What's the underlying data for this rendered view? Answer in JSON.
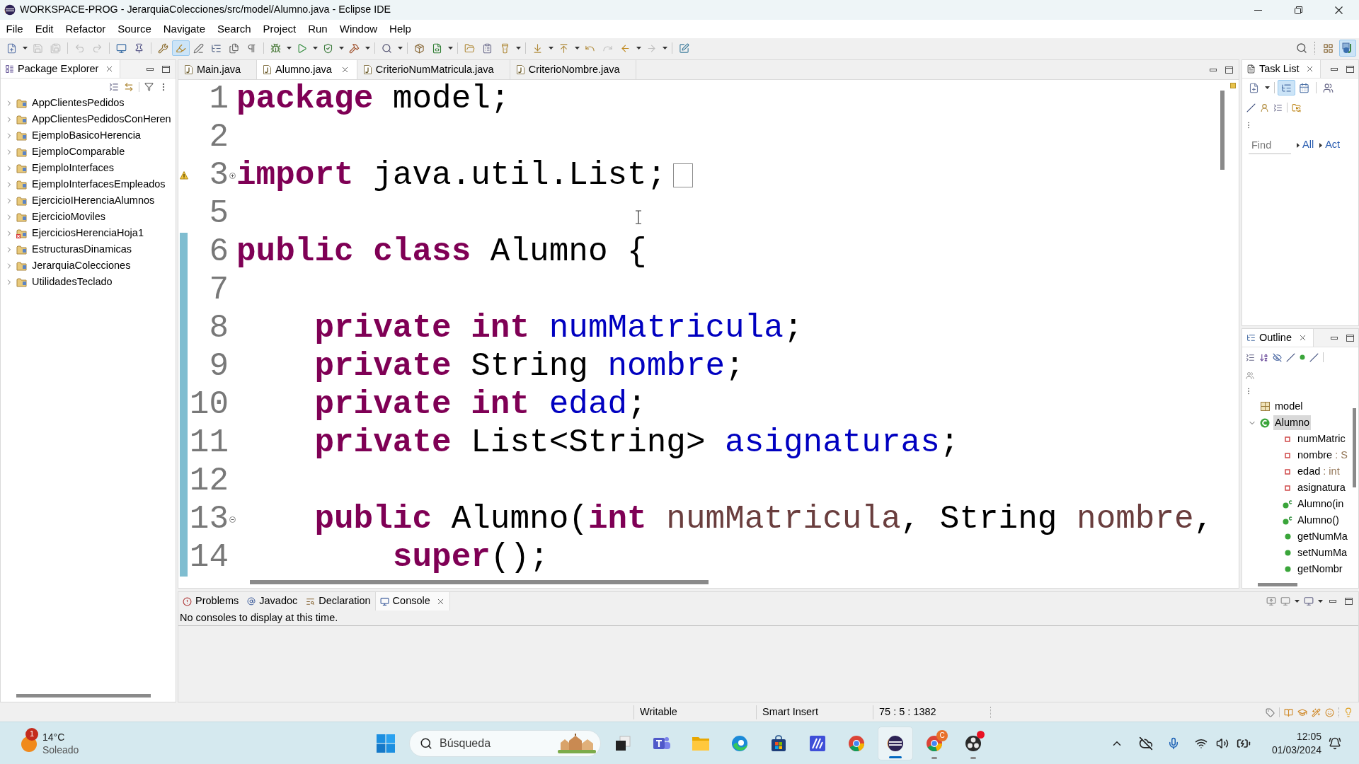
{
  "window": {
    "title": "WORKSPACE-PROG - JerarquiaColecciones/src/model/Alumno.java - Eclipse IDE"
  },
  "menu": [
    "File",
    "Edit",
    "Refactor",
    "Source",
    "Navigate",
    "Search",
    "Project",
    "Run",
    "Window",
    "Help"
  ],
  "toolbar": {
    "groups": [
      {
        "buttons": [
          {
            "disabled": false,
            "pressed": false
          },
          {
            "disabled": true,
            "pressed": false
          },
          {
            "disabled": true,
            "pressed": false
          }
        ]
      },
      {
        "buttons": [
          {
            "disabled": true,
            "pressed": false
          },
          {
            "disabled": true,
            "pressed": false
          }
        ]
      },
      {
        "buttons": [
          {
            "disabled": false,
            "pressed": false
          },
          {
            "disabled": false,
            "pressed": false
          }
        ]
      },
      {
        "buttons": [
          {
            "disabled": false,
            "pressed": false
          },
          {
            "disabled": false,
            "pressed": true
          },
          {
            "disabled": false,
            "pressed": false
          },
          {
            "disabled": false,
            "pressed": false
          },
          {
            "disabled": false,
            "pressed": false
          },
          {
            "disabled": false,
            "pressed": false
          }
        ]
      },
      {
        "buttons": [
          {
            "disabled": false,
            "pressed": false
          },
          {
            "disabled": false,
            "pressed": false
          },
          {
            "disabled": false,
            "pressed": false
          },
          {
            "disabled": false,
            "pressed": false
          }
        ]
      },
      {
        "buttons": [
          {
            "disabled": false,
            "pressed": false
          }
        ]
      },
      {
        "buttons": [
          {
            "disabled": false,
            "pressed": false
          },
          {
            "disabled": false,
            "pressed": false
          }
        ]
      },
      {
        "buttons": [
          {
            "disabled": false,
            "pressed": false
          },
          {
            "disabled": false,
            "pressed": false
          },
          {
            "disabled": false,
            "pressed": false
          }
        ]
      },
      {
        "buttons": [
          {
            "disabled": false,
            "pressed": false
          },
          {
            "disabled": false,
            "pressed": false
          },
          {
            "disabled": false,
            "pressed": false
          },
          {
            "disabled": true,
            "pressed": false
          },
          {
            "disabled": false,
            "pressed": false
          },
          {
            "disabled": true,
            "pressed": false
          }
        ]
      },
      {
        "buttons": [
          {
            "disabled": false,
            "pressed": false
          }
        ]
      }
    ],
    "perspectives": [
      {
        "pressed": false
      },
      {
        "pressed": true
      }
    ]
  },
  "package_explorer": {
    "title": "Package Explorer",
    "items": [
      {
        "label": "AppClientesPedidos",
        "expanded": false,
        "error": false
      },
      {
        "label": "AppClientesPedidosConHeren",
        "expanded": false,
        "error": false
      },
      {
        "label": "EjemploBasicoHerencia",
        "expanded": false,
        "error": false
      },
      {
        "label": "EjemploComparable",
        "expanded": false,
        "error": false
      },
      {
        "label": "EjemploInterfaces",
        "expanded": false,
        "error": false
      },
      {
        "label": "EjemploInterfacesEmpleados",
        "expanded": false,
        "error": false
      },
      {
        "label": "EjercicioIHerenciaAlumnos",
        "expanded": false,
        "error": false
      },
      {
        "label": "EjercicioMoviles",
        "expanded": false,
        "error": false
      },
      {
        "label": "EjerciciosHerenciaHoja1",
        "expanded": false,
        "error": true
      },
      {
        "label": "EstructurasDinamicas",
        "expanded": false,
        "error": false
      },
      {
        "label": "JerarquiaColecciones",
        "expanded": false,
        "error": false
      },
      {
        "label": "UtilidadesTeclado",
        "expanded": false,
        "error": false
      }
    ]
  },
  "editor": {
    "tabs": [
      {
        "label": "Main.java",
        "selected": false
      },
      {
        "label": "Alumno.java",
        "selected": true
      },
      {
        "label": "CriterioNumMatricula.java",
        "selected": false
      },
      {
        "label": "CriterioNombre.java",
        "selected": false
      }
    ],
    "lines": [
      {
        "number": "1",
        "changed": false,
        "warning": false,
        "tokens": [
          {
            "kind": "keyword",
            "text": "package"
          },
          {
            "kind": "plain",
            "text": " model;"
          }
        ]
      },
      {
        "number": "2",
        "changed": false,
        "warning": false
      },
      {
        "number": "3",
        "changed": false,
        "warning": true,
        "collapsed": true,
        "tokens": [
          {
            "kind": "keyword",
            "text": "import"
          },
          {
            "kind": "plain",
            "text": " java.util.List;"
          }
        ]
      },
      {
        "number": "5",
        "changed": false,
        "warning": false
      },
      {
        "number": "6",
        "changed": true,
        "warning": false,
        "tokens": [
          {
            "kind": "keyword",
            "text": "public class"
          },
          {
            "kind": "plain",
            "text": " Alumno {"
          }
        ],
        "children": [
          {
            "number": "7",
            "changed": true,
            "warning": false
          },
          {
            "number": "8",
            "changed": true,
            "warning": false,
            "tokens": [
              {
                "kind": "keyword",
                "text": "private int "
              },
              {
                "kind": "field",
                "text": "numMatricula"
              },
              {
                "kind": "plain",
                "text": ";"
              }
            ]
          },
          {
            "number": "9",
            "changed": true,
            "warning": false,
            "tokens": [
              {
                "kind": "keyword",
                "text": "private"
              },
              {
                "kind": "plain",
                "text": " String "
              },
              {
                "kind": "field",
                "text": "nombre"
              },
              {
                "kind": "plain",
                "text": ";"
              }
            ]
          },
          {
            "number": "10",
            "changed": true,
            "warning": false,
            "tokens": [
              {
                "kind": "keyword",
                "text": "private int "
              },
              {
                "kind": "field",
                "text": "edad"
              },
              {
                "kind": "plain",
                "text": ";"
              }
            ]
          },
          {
            "number": "11",
            "changed": true,
            "warning": false,
            "tokens": [
              {
                "kind": "keyword",
                "text": "private"
              },
              {
                "kind": "plain",
                "text": " List<String> "
              },
              {
                "kind": "field",
                "text": "asignaturas"
              },
              {
                "kind": "plain",
                "text": ";"
              }
            ]
          },
          {
            "number": "12",
            "changed": true,
            "warning": false
          },
          {
            "number": "13",
            "changed": true,
            "warning": false,
            "collapsed": false,
            "tokens": [
              {
                "kind": "keyword",
                "text": "public"
              },
              {
                "kind": "plain",
                "text": " Alumno("
              },
              {
                "kind": "keyword",
                "text": "int "
              },
              {
                "kind": "param",
                "text": "numMatricula"
              },
              {
                "kind": "plain",
                "text": ", String "
              },
              {
                "kind": "param",
                "text": "nombre"
              },
              {
                "kind": "plain",
                "text": ","
              }
            ],
            "children": [
              {
                "number": "14",
                "changed": true,
                "warning": false,
                "tokens": [
                  {
                    "kind": "keyword",
                    "text": "super"
                  },
                  {
                    "kind": "plain",
                    "text": "();"
                  }
                ]
              }
            ]
          }
        ]
      }
    ]
  },
  "task_list": {
    "title": "Task List",
    "tools": [
      {
        "pressed": false
      },
      {
        "pressed": true
      },
      {
        "pressed": false
      },
      {
        "pressed": false
      }
    ],
    "find": {
      "placeholder": "Find"
    },
    "filters": [
      "All",
      "Act"
    ]
  },
  "outline": {
    "title": "Outline",
    "items": [
      {
        "kind": "package",
        "label": "model",
        "selected": false
      },
      {
        "kind": "class",
        "label": "Alumno",
        "selected": true,
        "expanded": true,
        "children": [
          {
            "kind": "field",
            "label": "numMatric",
            "selected": false
          },
          {
            "kind": "field",
            "label": "nombre",
            "type": ": S",
            "selected": false
          },
          {
            "kind": "field",
            "label": "edad",
            "type": ": int",
            "selected": false
          },
          {
            "kind": "field",
            "label": "asignatura",
            "selected": false
          },
          {
            "kind": "constructor",
            "label": "Alumno(in",
            "selected": false
          },
          {
            "kind": "constructor",
            "label": "Alumno()",
            "selected": false
          },
          {
            "kind": "method",
            "label": "getNumMa",
            "selected": false
          },
          {
            "kind": "method",
            "label": "setNumMa",
            "selected": false
          },
          {
            "kind": "method",
            "label": "getNombr",
            "selected": false
          }
        ]
      }
    ]
  },
  "bottom_panel": {
    "tabs": [
      {
        "kind": "problems",
        "label": "Problems",
        "selected": false
      },
      {
        "kind": "javadoc",
        "label": "Javadoc",
        "selected": false
      },
      {
        "kind": "declaration",
        "label": "Declaration",
        "selected": false
      },
      {
        "kind": "console",
        "label": "Console",
        "selected": true
      }
    ],
    "message": "No consoles to display at this time."
  },
  "status_bar": {
    "fields": [
      "Writable",
      "Smart Insert",
      "75 : 5 : 1382"
    ]
  },
  "taskbar": {
    "weather": {
      "badge": "1",
      "temperature": "14°C",
      "condition": "Soleado"
    },
    "search": {
      "placeholder": "Búsqueda"
    },
    "apps": [
      {
        "selected": false,
        "running": false,
        "notification": false
      },
      {
        "selected": false,
        "running": false,
        "notification": false
      },
      {
        "selected": false,
        "running": false,
        "notification": false
      },
      {
        "selected": false,
        "running": false,
        "notification": false
      },
      {
        "selected": false,
        "running": false,
        "notification": false
      },
      {
        "selected": false,
        "running": false,
        "notification": false
      },
      {
        "selected": false,
        "running": false,
        "notification": false
      },
      {
        "selected": true,
        "running": true,
        "notification": false
      },
      {
        "selected": false,
        "running": true,
        "notification": false,
        "badge": "C"
      },
      {
        "selected": false,
        "running": true,
        "notification": true
      }
    ],
    "clock": {
      "time": "12:05",
      "date": "01/03/2024"
    }
  }
}
